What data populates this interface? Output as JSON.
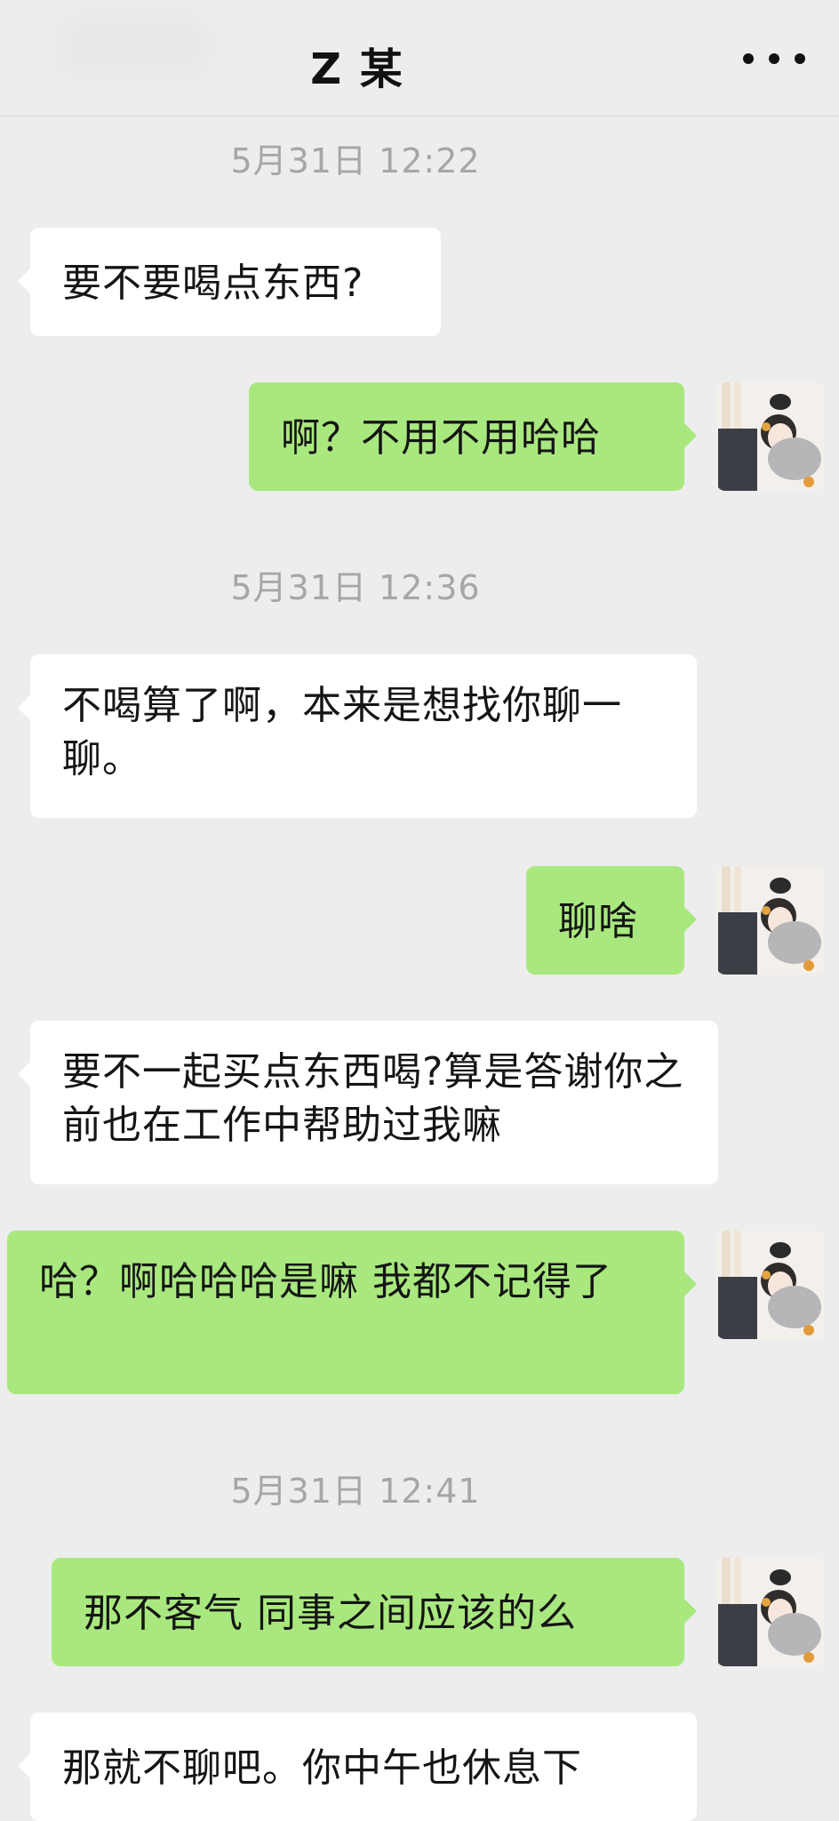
{
  "header": {
    "title": "Z 某",
    "more_icon": "more-dots-icon"
  },
  "messages": [
    {
      "type": "time",
      "text": "5月31日 12:22"
    },
    {
      "type": "left",
      "text": "要不要喝点东西?"
    },
    {
      "type": "right",
      "text": "啊？不用不用哈哈"
    },
    {
      "type": "time",
      "text": "5月31日 12:36"
    },
    {
      "type": "left",
      "text": "不喝算了啊，本来是想找你聊一聊。"
    },
    {
      "type": "right",
      "text": "聊啥"
    },
    {
      "type": "left",
      "text": "要不一起买点东西喝?算是答谢你之前也在工作中帮助过我嘛"
    },
    {
      "type": "right",
      "text": "哈？啊哈哈哈是嘛 我都不记得了"
    },
    {
      "type": "time",
      "text": "5月31日 12:41"
    },
    {
      "type": "right",
      "text": "那不客气 同事之间应该的么"
    },
    {
      "type": "left",
      "text": "那就不聊吧。你中午也休息下"
    }
  ],
  "colors": {
    "background": "#ededed",
    "self_bubble": "#a9e87f",
    "other_bubble": "#ffffff",
    "timestamp": "#a6a6a6"
  }
}
